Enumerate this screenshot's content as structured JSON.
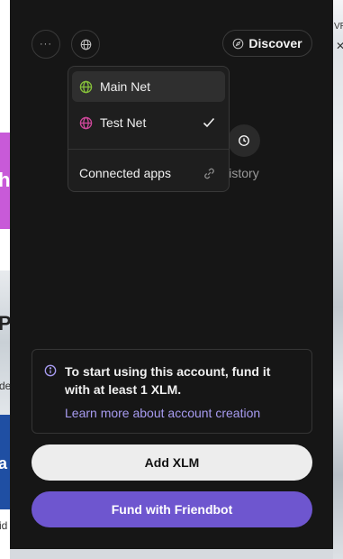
{
  "background": {
    "left_fragments": [
      "h",
      "P",
      "de",
      "a",
      "id"
    ],
    "right_fragments": [
      "VR",
      "✕"
    ]
  },
  "header": {
    "more_icon": "more-icon",
    "network_icon": "globe-icon",
    "discover_label": "Discover",
    "discover_icon": "compass-icon"
  },
  "network_menu": {
    "items": [
      {
        "label": "Main Net",
        "icon": "globe-icon",
        "color": "#86c03a",
        "selected": false
      },
      {
        "label": "Test Net",
        "icon": "globe-icon",
        "color": "#d0479b",
        "selected": true
      }
    ],
    "connected_apps_label": "Connected apps",
    "connected_apps_icon": "link-icon"
  },
  "actions": {
    "history_label": "istory"
  },
  "info": {
    "text": "To start using this account, fund it with at least 1 XLM.",
    "link": "Learn more about account creation"
  },
  "buttons": {
    "add_xlm": "Add XLM",
    "fund_friendbot": "Fund with Friendbot"
  },
  "colors": {
    "popup_bg": "#161616",
    "accent": "#6e56cf",
    "link": "#a79bf0",
    "main_net": "#86c03a",
    "test_net": "#d0479b"
  }
}
